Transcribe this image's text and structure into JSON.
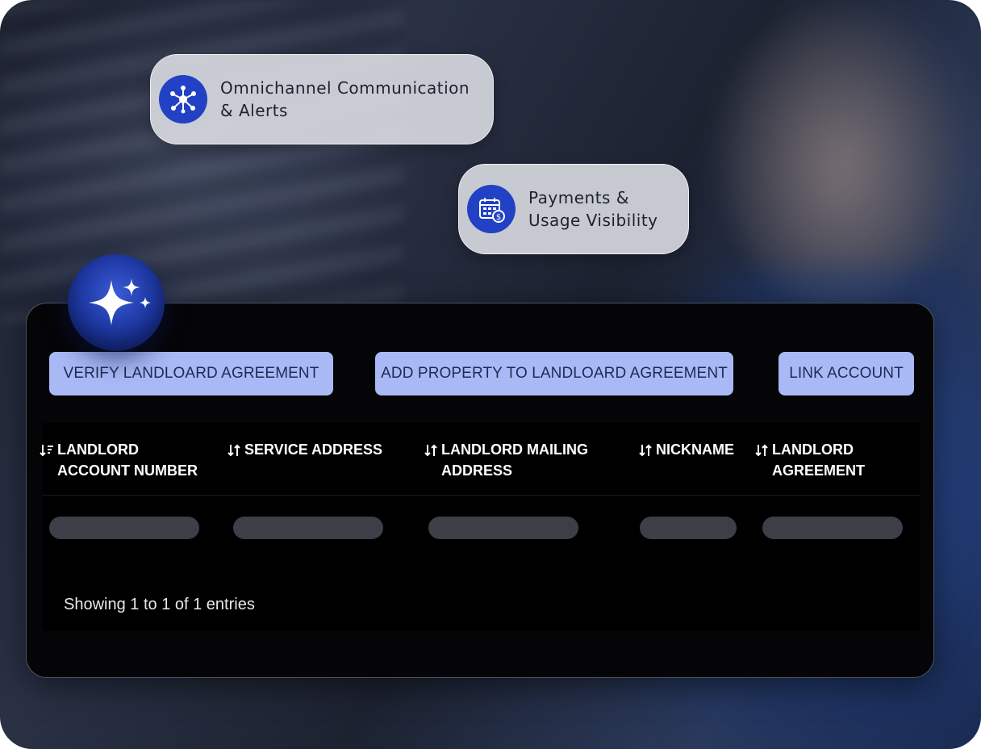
{
  "features": [
    {
      "label": "Omnichannel Communication\n& Alerts",
      "icon": "network-nodes-icon"
    },
    {
      "label": "Payments &\nUsage Visibility",
      "icon": "calendar-payment-icon"
    }
  ],
  "assistant": {
    "icon": "sparkle-icon"
  },
  "actions": {
    "verify_label": "VERIFY LANDLOARD AGREEMENT",
    "add_label": "ADD PROPERTY TO LANDLOARD AGREEMENT",
    "link_label": "LINK ACCOUNT"
  },
  "table": {
    "columns": [
      {
        "label": "LANDLORD ACCOUNT NUMBER",
        "sort": "sorted-descending-icon"
      },
      {
        "label": "SERVICE ADDRESS",
        "sort": "sort-icon"
      },
      {
        "label": "LANDLORD MAILING ADDRESS",
        "sort": "sort-icon"
      },
      {
        "label": "NICKNAME",
        "sort": "sort-icon"
      },
      {
        "label": "LANDLORD AGREEMENT",
        "sort": "sort-icon"
      }
    ],
    "rows_loading": true,
    "footer": "Showing 1 to 1 of 1 entries"
  },
  "colors": {
    "accent_button": "#a9b9f6",
    "icon_circle": "#2241c4",
    "panel_bg": "#050507",
    "skeleton": "#3c3f47"
  }
}
